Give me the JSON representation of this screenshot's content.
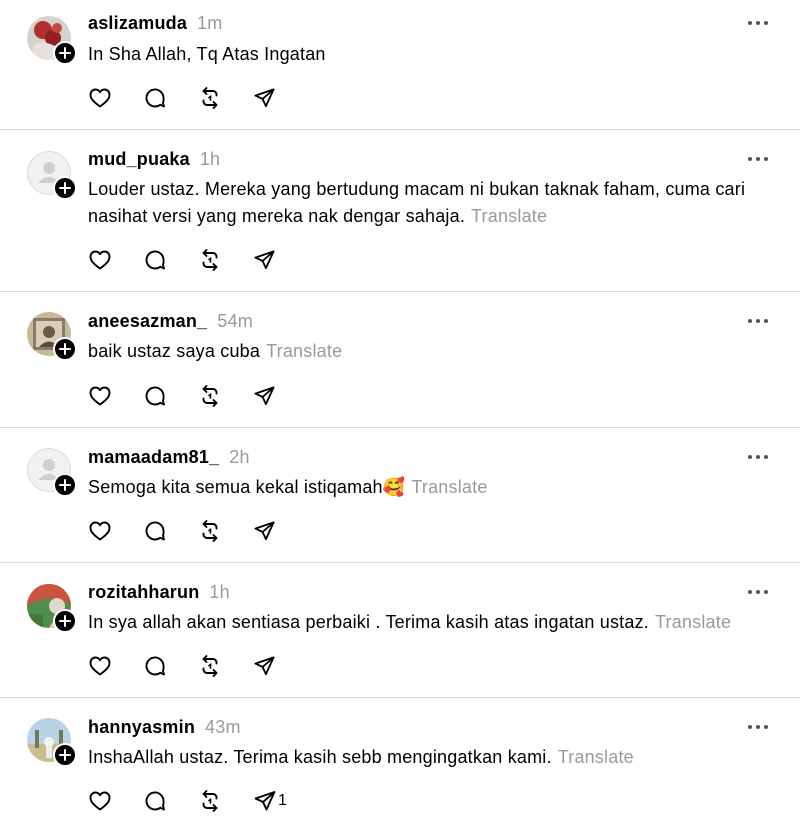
{
  "posts": [
    {
      "username": "aslizamuda",
      "time": "1m",
      "text": "In Sha Allah, Tq Atas Ingatan",
      "translate": "",
      "avatar": "photo-red",
      "share_count": ""
    },
    {
      "username": "mud_puaka",
      "time": "1h",
      "text": "Louder ustaz. Mereka yang bertudung macam ni bukan taknak faham, cuma cari nasihat versi yang mereka nak dengar sahaja.",
      "translate": "Translate",
      "avatar": "default",
      "share_count": ""
    },
    {
      "username": "aneesazman_",
      "time": "54m",
      "text": "baik ustaz saya cuba",
      "translate": "Translate",
      "avatar": "photo-frame",
      "share_count": ""
    },
    {
      "username": "mamaadam81_",
      "time": "2h",
      "text": "Semoga kita semua kekal istiqamah🥰",
      "translate": "Translate",
      "avatar": "default",
      "share_count": ""
    },
    {
      "username": "rozitahharun",
      "time": "1h",
      "text": "In sya allah akan sentiasa perbaiki . Terima kasih atas ingatan ustaz.",
      "translate": "Translate",
      "avatar": "photo-green",
      "share_count": ""
    },
    {
      "username": "hannyasmin",
      "time": "43m",
      "text": "InshaAllah ustaz. Terima kasih sebb mengingatkan kami.",
      "translate": "Translate",
      "avatar": "photo-sky",
      "share_count": "1"
    }
  ],
  "icons": {
    "like": "heart-icon",
    "reply": "comment-icon",
    "repost": "repost-icon",
    "share": "send-icon",
    "more": "more-icon",
    "follow": "plus-icon"
  },
  "colors": {
    "text": "#000000",
    "muted": "#9a9a9a",
    "divider": "#dcdcdc",
    "background": "#ffffff"
  }
}
